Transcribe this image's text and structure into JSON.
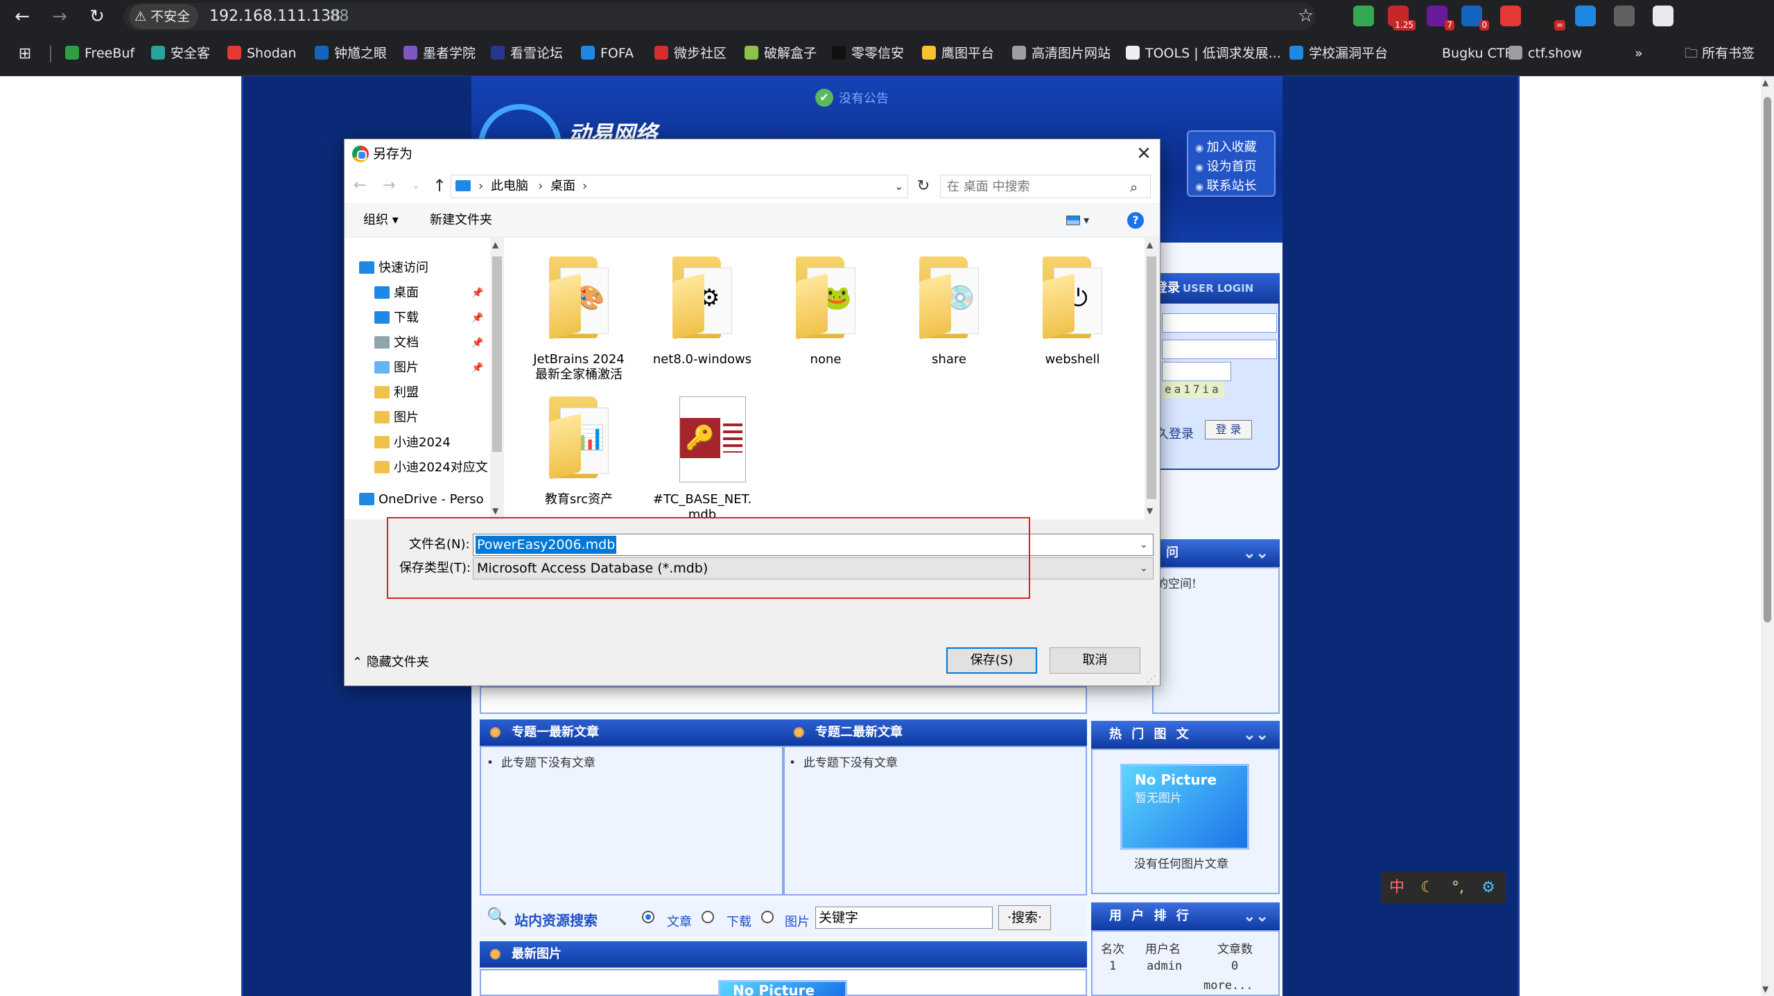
{
  "browser": {
    "security_label": "不安全",
    "url_host": "192.168.111.138",
    "url_port": ":88",
    "extensions": [
      {
        "icon": "shield-icon",
        "color": "#34a853",
        "badge": ""
      },
      {
        "icon": "translate-icon",
        "color": "#c62828",
        "badge": "1.25"
      },
      {
        "icon": "shield-purple-icon",
        "color": "#6a1b9a",
        "badge": "7"
      },
      {
        "icon": "clipboard-icon",
        "color": "#1565c0",
        "badge": "0"
      },
      {
        "icon": "proxy-icon",
        "color": "#e53935",
        "badge": ""
      },
      {
        "icon": "wappalyzer-icon",
        "color": "#212121",
        "badge": "="
      },
      {
        "icon": "link-icon",
        "color": "#1e88e5",
        "badge": ""
      },
      {
        "icon": "glasses-icon",
        "color": "#616161",
        "badge": ""
      },
      {
        "icon": "puzzle-icon",
        "color": "#e8eaed",
        "badge": ""
      }
    ],
    "bookmarks": [
      {
        "label": "FreeBuf",
        "color": "#2ea043"
      },
      {
        "label": "安全客",
        "color": "#26a69a"
      },
      {
        "label": "Shodan",
        "color": "#e53935"
      },
      {
        "label": "钟馗之眼",
        "color": "#1565c0"
      },
      {
        "label": "墨者学院",
        "color": "#7e57c2"
      },
      {
        "label": "看雪论坛",
        "color": "#283593"
      },
      {
        "label": "FOFA",
        "color": "#1e88e5"
      },
      {
        "label": "微步社区",
        "color": "#d32f2f"
      },
      {
        "label": "破解盒子",
        "color": "#8bc34a"
      },
      {
        "label": "零零信安",
        "color": "#111111"
      },
      {
        "label": "鹰图平台",
        "color": "#fbc02d"
      },
      {
        "label": "高清图片网站",
        "color": "#9e9e9e"
      },
      {
        "label": "TOOLS | 低调求发展...",
        "color": "#eeeeee"
      },
      {
        "label": "学校漏洞平台",
        "color": "#1e88e5"
      },
      {
        "label": "Bugku CTF",
        "color": "#202124"
      },
      {
        "label": "ctf.show",
        "color": "#9e9e9e"
      }
    ],
    "all_bookmarks": "所有书签",
    "overflow": "»"
  },
  "site": {
    "notice": "没有公告",
    "logo_text": "动易网络",
    "quick_links": [
      "加入收藏",
      "设为首页",
      "联系站长"
    ],
    "login": {
      "title": "登录",
      "title_en": "USER LOGIN",
      "captcha": "ea17ia",
      "remember": "久登录",
      "button": "登 录"
    },
    "question_panel": {
      "head": "问",
      "text": "的空间!"
    },
    "special1": {
      "title": "专题一最新文章",
      "item": "此专题下没有文章"
    },
    "special2": {
      "title": "专题二最新文章",
      "item": "此专题下没有文章"
    },
    "hot_pics": {
      "title": "热 门 图 文",
      "nopic": "No Picture",
      "nopic_cn": "暂无图片",
      "caption": "没有任何图片文章"
    },
    "search": {
      "title": "站内资源搜索",
      "options": [
        "文章",
        "下载",
        "图片"
      ],
      "keyword": "关键字",
      "button": "·搜索·"
    },
    "ranking": {
      "title": "用 户 排 行",
      "headers": [
        "名次",
        "用户名",
        "文章数"
      ],
      "rows": [
        [
          "1",
          "admin",
          "0"
        ]
      ],
      "more": "more..."
    },
    "latest_pics": {
      "title": "最新图片",
      "nopic": "No Picture"
    },
    "float_tools": [
      "中",
      "☾",
      "°,",
      "⚙"
    ]
  },
  "dialog": {
    "title": "另存为",
    "breadcrumb": [
      "此电脑",
      "桌面"
    ],
    "search_placeholder": "在 桌面 中搜索",
    "organize": "组织 ▾",
    "new_folder": "新建文件夹",
    "help": "?",
    "nav": [
      {
        "label": "快速访问",
        "icon": "star-icon",
        "pinned": false,
        "color": "#1e88e5"
      },
      {
        "label": "桌面",
        "icon": "desktop-icon",
        "pinned": true,
        "color": "#1e88e5"
      },
      {
        "label": "下载",
        "icon": "download-icon",
        "pinned": true,
        "color": "#1e88e5"
      },
      {
        "label": "文档",
        "icon": "document-icon",
        "pinned": true,
        "color": "#90a4ae"
      },
      {
        "label": "图片",
        "icon": "pictures-icon",
        "pinned": true,
        "color": "#64b5f6"
      },
      {
        "label": "利盟",
        "icon": "folder-icon",
        "pinned": false,
        "color": "#f0c24b"
      },
      {
        "label": "图片",
        "icon": "folder-icon",
        "pinned": false,
        "color": "#f0c24b"
      },
      {
        "label": "小迪2024",
        "icon": "folder-icon",
        "pinned": false,
        "color": "#f0c24b"
      },
      {
        "label": "小迪2024对应文",
        "icon": "folder-icon",
        "pinned": false,
        "color": "#f0c24b"
      },
      {
        "label": "OneDrive - Perso",
        "icon": "onedrive-icon",
        "pinned": false,
        "color": "#1e88e5"
      }
    ],
    "files": [
      {
        "label": "JetBrains 2024\n最新全家桶激活",
        "type": "folder",
        "deco": "🎨"
      },
      {
        "label": "net8.0-windows",
        "type": "folder",
        "deco": "⚙"
      },
      {
        "label": "none",
        "type": "folder",
        "deco": "🐸"
      },
      {
        "label": "share",
        "type": "folder",
        "deco": "💿"
      },
      {
        "label": "webshell",
        "type": "folder",
        "deco": "⏻"
      },
      {
        "label": "教育src资产",
        "type": "folder",
        "deco": "📊"
      },
      {
        "label": "#TC_BASE_NET.\nmdb",
        "type": "mdb",
        "deco": "🔑"
      }
    ],
    "filename_label": "文件名(N):",
    "filename_value": "PowerEasy2006.mdb",
    "filetype_label": "保存类型(T):",
    "filetype_value": "Microsoft Access Database (*.mdb)",
    "hide_folders": "隐藏文件夹",
    "save_button": "保存(S)",
    "cancel_button": "取消"
  }
}
